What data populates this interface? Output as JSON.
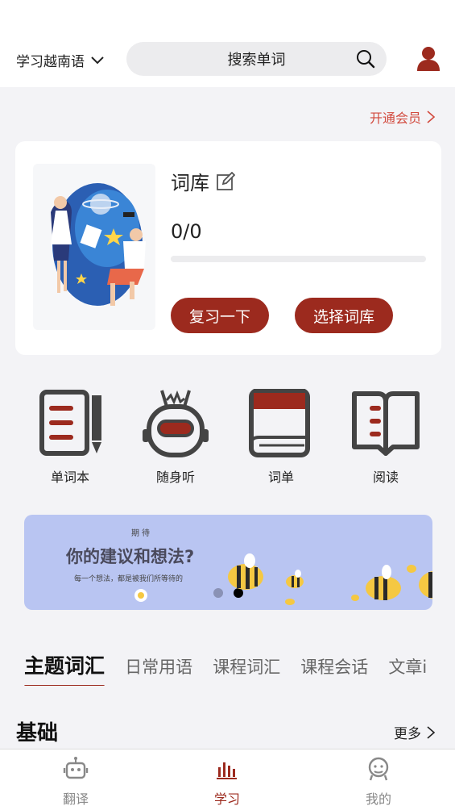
{
  "header": {
    "language": "学习越南语",
    "search_placeholder": "搜索单词"
  },
  "vip_link": "开通会员",
  "card": {
    "title": "词库",
    "progress_text": "0/0",
    "progress_fraction": 0,
    "review_button": "复习一下",
    "choose_button": "选择词库"
  },
  "features": [
    {
      "label": "单词本",
      "icon": "notebook-icon"
    },
    {
      "label": "随身听",
      "icon": "robot-radio-icon"
    },
    {
      "label": "词单",
      "icon": "book-icon"
    },
    {
      "label": "阅读",
      "icon": "open-book-icon"
    }
  ],
  "banner": {
    "tag": "期待",
    "headline": "你的建议和想法?",
    "sub": "每一个想法，都是被我们所等待的"
  },
  "tabs": [
    "主题词汇",
    "日常用语",
    "课程词汇",
    "课程会话",
    "文章i"
  ],
  "section": {
    "title": "基础",
    "more": "更多"
  },
  "bottom_nav": [
    {
      "label": "翻译",
      "icon": "robot-icon",
      "active": false
    },
    {
      "label": "学习",
      "icon": "bars-icon",
      "active": true
    },
    {
      "label": "我的",
      "icon": "face-icon",
      "active": false
    }
  ],
  "colors": {
    "accent": "#9c2a1e",
    "vip": "#d24a3e",
    "banner": "#b9c5f2",
    "background": "#f3f3f6"
  }
}
